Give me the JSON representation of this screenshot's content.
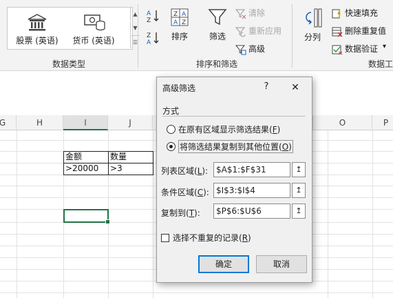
{
  "ribbon": {
    "data_types": {
      "items": [
        {
          "label": "股票 (英语)",
          "icon": "bank-icon"
        },
        {
          "label": "货币 (英语)",
          "icon": "currency-icon"
        }
      ],
      "group_label": "数据类型"
    },
    "sort_filter": {
      "sort_label": "排序",
      "filter_label": "筛选",
      "clear_label": "清除",
      "reapply_label": "重新应用",
      "advanced_label": "高级",
      "group_label": "排序和筛选"
    },
    "data_tools": {
      "split_label": "分列",
      "flash_fill_label": "快速填充",
      "remove_dup_label": "删除重复值",
      "validation_label": "数据验证",
      "group_label": "数据工"
    }
  },
  "sheet": {
    "columns": [
      "G",
      "H",
      "I",
      "J",
      "O",
      "P"
    ],
    "criteria": {
      "headers": [
        "金额",
        "数量"
      ],
      "values": [
        ">20000",
        ">3"
      ]
    }
  },
  "dialog": {
    "title": "高级筛选",
    "help": "?",
    "close": "✕",
    "section_label": "方式",
    "option1": {
      "text": "在原有区域显示筛选结果(",
      "key": "F",
      "suffix": ")"
    },
    "option2": {
      "text": "将筛选结果复制到其他位置(",
      "key": "O",
      "suffix": ")"
    },
    "list_range": {
      "label": "列表区域(",
      "key": "L",
      "suffix": "):",
      "value": "$A$1:$F$31"
    },
    "criteria_range": {
      "label": "条件区域(",
      "key": "C",
      "suffix": "):",
      "value": "$I$3:$I$4"
    },
    "copy_to": {
      "label": "复制到(",
      "key": "T",
      "suffix": "):",
      "value": "$P$6:$U$6"
    },
    "unique": {
      "text": "选择不重复的记录(",
      "key": "R",
      "suffix": ")"
    },
    "ok_label": "确定",
    "cancel_label": "取消",
    "collapse_icon": "↥"
  }
}
